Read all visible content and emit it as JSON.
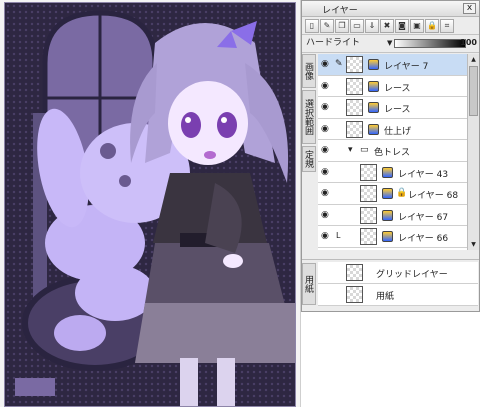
{
  "panel": {
    "title": "レイヤー",
    "close_label": "x",
    "toolbar": [
      "new-layer",
      "new-folder",
      "copy",
      "merge",
      "delete",
      "mask",
      "clip",
      "lock-alpha",
      "lock",
      "transform"
    ],
    "blend_mode": "ハードライト",
    "opacity": "100",
    "side_tabs": [
      "画像",
      "選択範囲",
      "定規"
    ],
    "paper_tab": "用紙"
  },
  "layers": [
    {
      "name": "レイヤー 7",
      "indent": 0,
      "selected": true,
      "pen": true
    },
    {
      "name": "レース",
      "indent": 0
    },
    {
      "name": "レース",
      "indent": 0
    },
    {
      "name": "仕上げ",
      "indent": 0
    },
    {
      "name": "色トレス",
      "indent": 0,
      "folder": true
    },
    {
      "name": "レイヤー 43",
      "indent": 1
    },
    {
      "name": "レイヤー 68",
      "indent": 1,
      "lock": true
    },
    {
      "name": "レイヤー 67",
      "indent": 1
    },
    {
      "name": "レイヤー 66",
      "indent": 1,
      "mark": "L"
    }
  ],
  "bottom_layers": [
    {
      "name": "グリッドレイヤー"
    },
    {
      "name": "用紙"
    }
  ],
  "colors": {
    "accent": "#c8dcf4",
    "art_bg": "#2e2742",
    "art_main": "#b6a3ee"
  }
}
